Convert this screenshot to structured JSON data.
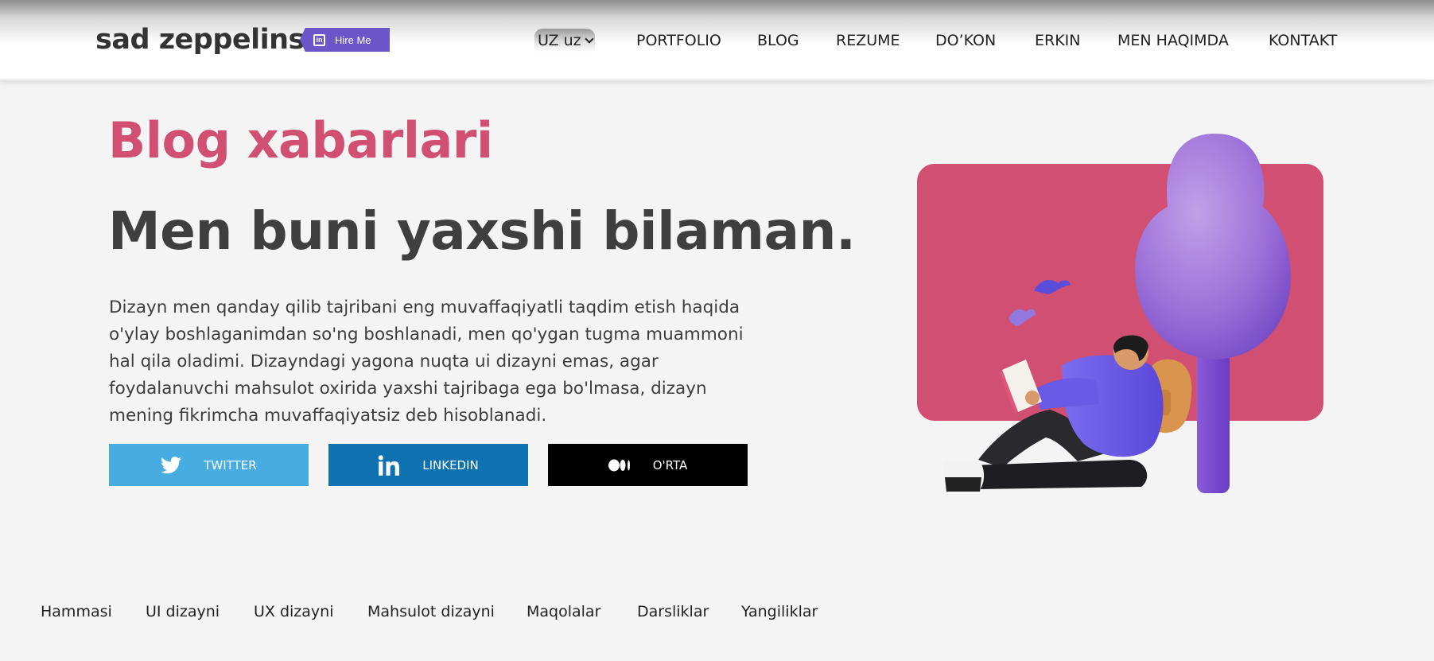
{
  "header": {
    "logo": "sad zeppelins",
    "hire_label": "Hire Me",
    "hire_icon": "linkedin-icon",
    "language": "UZ uz",
    "nav": [
      "PORTFOLIO",
      "BLOG",
      "REZUME",
      "DO’KON",
      "ERKIN",
      "MEN HAQIMDA",
      "KONTAKT"
    ]
  },
  "hero": {
    "eyebrow": "Blog xabarlari",
    "headline": "Men buni yaxshi bilaman.",
    "description": "Dizayn men qanday qilib tajribani eng muvaffaqiyatli taqdim etish haqida o'ylay boshlaganimdan so'ng boshlanadi, men qo'ygan tugma muammoni hal qila oladimi. Dizayndagi yagona nuqta ui dizayni emas, agar foydalanuvchi mahsulot oxirida yaxshi tajribaga ega bo'lmasa, dizayn mening fikrimcha muvaffaqiyatsiz deb hisoblanadi.",
    "social": [
      {
        "label": "TWITTER",
        "icon": "twitter-icon",
        "color": "#47ade0"
      },
      {
        "label": "LINKEDIN",
        "icon": "linkedin-icon",
        "color": "#0f72b0"
      },
      {
        "label": "O'RTA",
        "icon": "medium-icon",
        "color": "#000000"
      }
    ]
  },
  "filters": [
    "Hammasi",
    "UI dizayni",
    "UX dizayni",
    "Mahsulot dizayni",
    "Maqolalar",
    "Darsliklar",
    "Yangiliklar"
  ],
  "colors": {
    "accent": "#d04f72",
    "hire": "#6a56c8",
    "illustration_panel": "#d04f72",
    "tree": "#9a70d6"
  }
}
